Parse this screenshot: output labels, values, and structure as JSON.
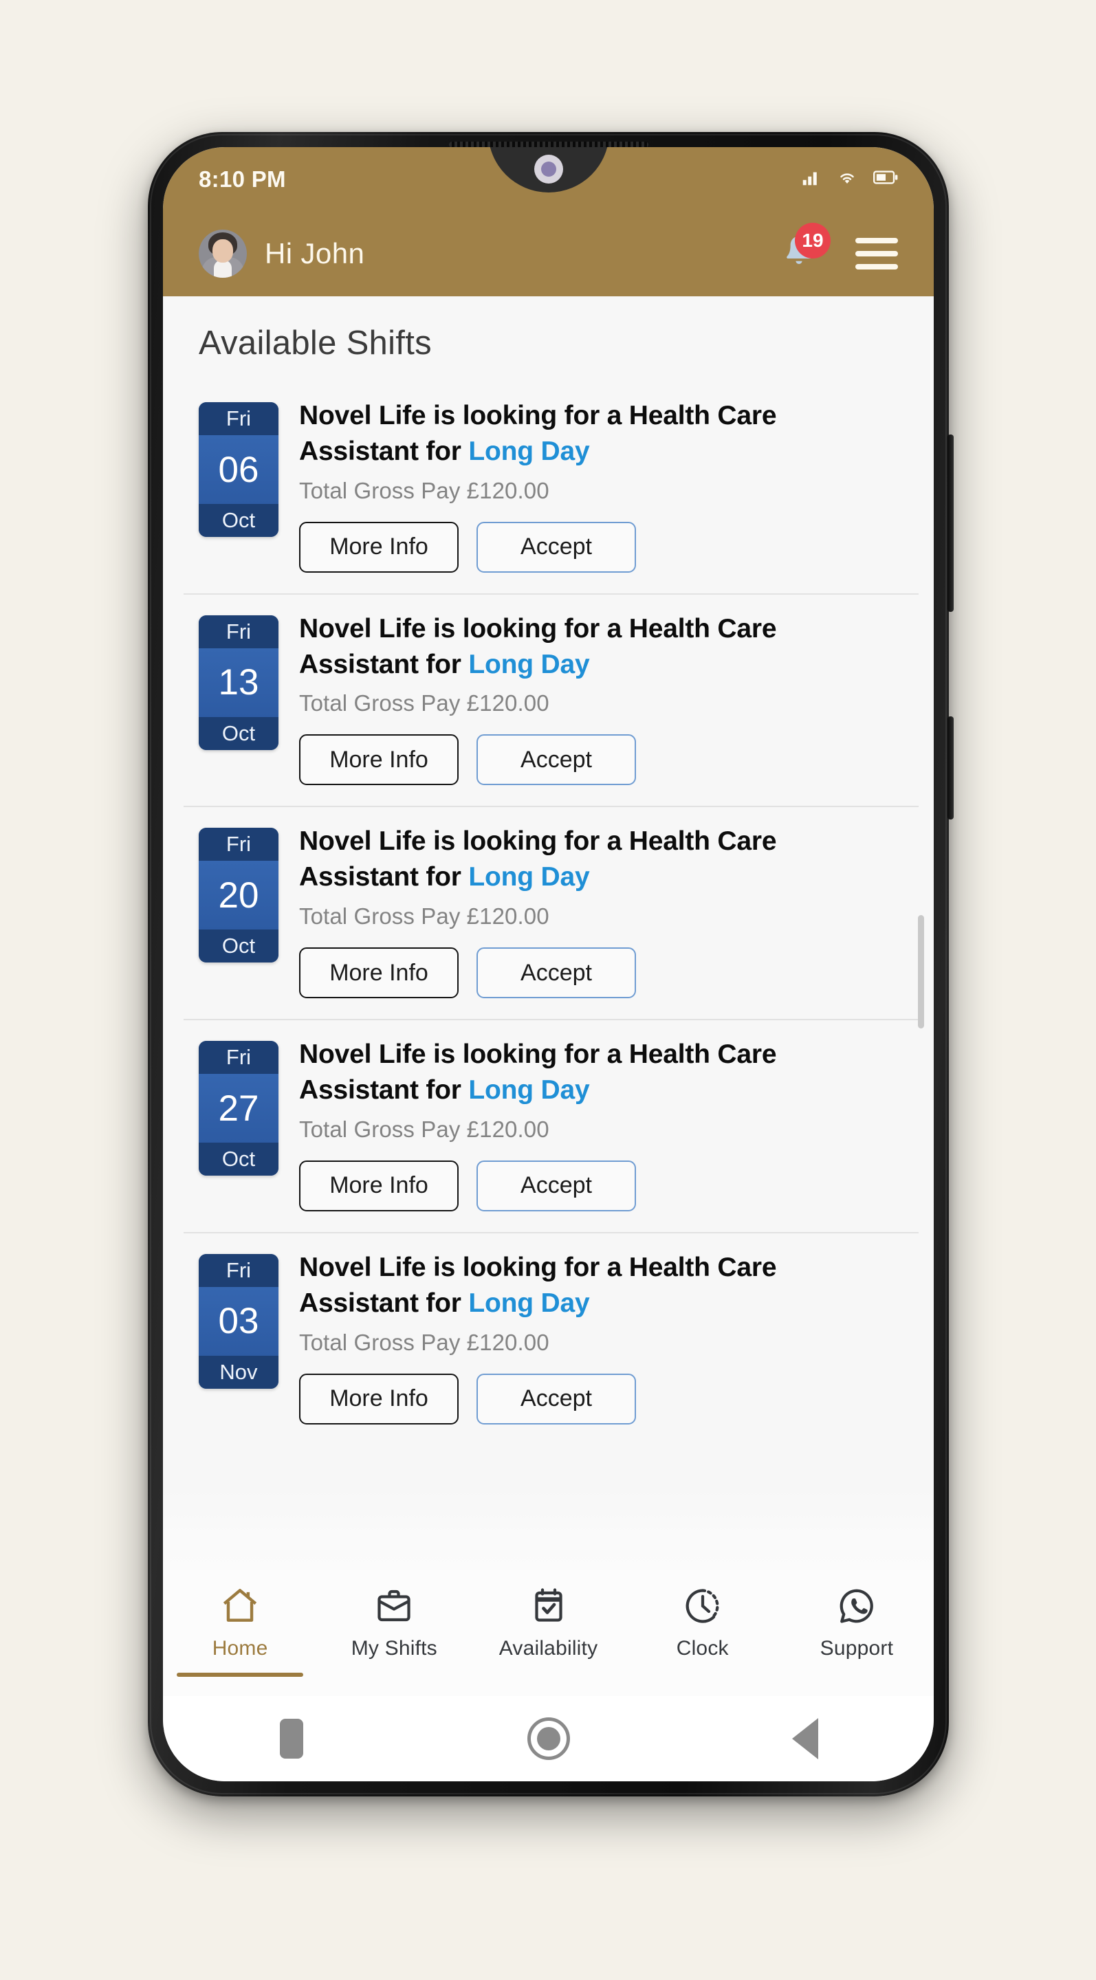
{
  "status_bar": {
    "time": "8:10 PM",
    "icons": [
      "signal-icon",
      "wifi-icon",
      "battery-icon"
    ]
  },
  "header": {
    "greeting": "Hi John",
    "avatar_name": "user-avatar",
    "bell_icon": "bell-icon",
    "notification_count": "19",
    "menu_icon": "hamburger-menu-icon",
    "background_color": "#a08148"
  },
  "content": {
    "page_title": "Available Shifts"
  },
  "shifts": [
    {
      "dow": "Fri",
      "day": "06",
      "month": "Oct",
      "title_prefix": "Novel Life is looking for a Health Care Assistant for ",
      "shift_type": "Long Day",
      "pay": "Total Gross Pay £120.00",
      "more_info_label": "More Info",
      "accept_label": "Accept"
    },
    {
      "dow": "Fri",
      "day": "13",
      "month": "Oct",
      "title_prefix": "Novel Life is looking for a Health Care Assistant for ",
      "shift_type": "Long Day",
      "pay": "Total Gross Pay £120.00",
      "more_info_label": "More Info",
      "accept_label": "Accept"
    },
    {
      "dow": "Fri",
      "day": "20",
      "month": "Oct",
      "title_prefix": "Novel Life is looking for a Health Care Assistant for ",
      "shift_type": "Long Day",
      "pay": "Total Gross Pay £120.00",
      "more_info_label": "More Info",
      "accept_label": "Accept"
    },
    {
      "dow": "Fri",
      "day": "27",
      "month": "Oct",
      "title_prefix": "Novel Life is looking for a Health Care Assistant for ",
      "shift_type": "Long Day",
      "pay": "Total Gross Pay £120.00",
      "more_info_label": "More Info",
      "accept_label": "Accept"
    },
    {
      "dow": "Fri",
      "day": "03",
      "month": "Nov",
      "title_prefix": "Novel Life is looking for a Health Care Assistant for ",
      "shift_type": "Long Day",
      "pay": "Total Gross Pay £120.00",
      "more_info_label": "More Info",
      "accept_label": "Accept"
    }
  ],
  "bottom_nav": {
    "active_index": 0,
    "active_color": "#9c7b3f",
    "items": [
      {
        "label": "Home",
        "icon": "home-icon"
      },
      {
        "label": "My Shifts",
        "icon": "briefcase-icon"
      },
      {
        "label": "Availability",
        "icon": "calendar-check-icon"
      },
      {
        "label": "Clock",
        "icon": "clock-icon"
      },
      {
        "label": "Support",
        "icon": "whatsapp-support-icon"
      }
    ]
  },
  "system_nav": {
    "recents": "recents-square-icon",
    "home": "home-circle-icon",
    "back": "back-triangle-icon"
  }
}
